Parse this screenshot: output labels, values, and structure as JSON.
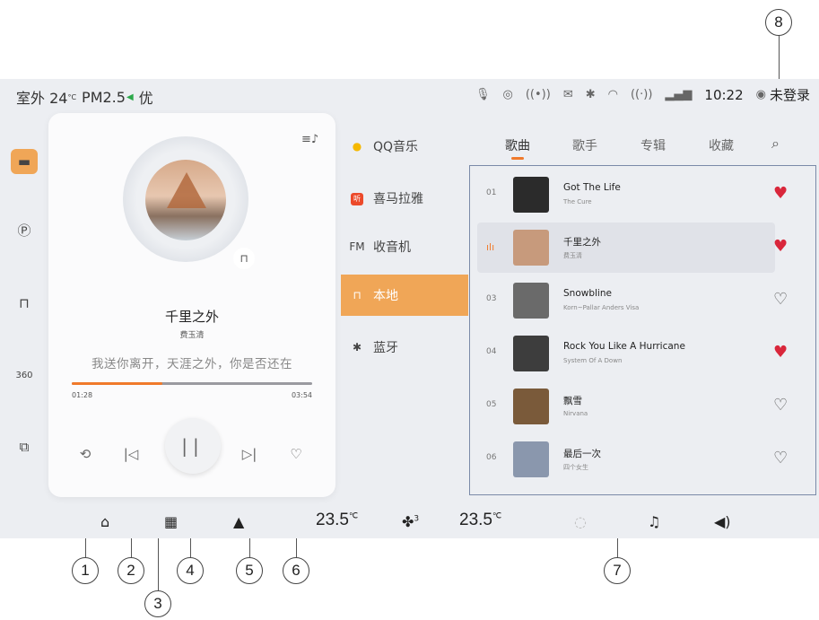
{
  "status": {
    "outdoor": "室外 24",
    "temp_unit": "°C",
    "pm": "PM2.5",
    "air": "优",
    "time": "10:22",
    "login": "未登录"
  },
  "player": {
    "title": "千里之外",
    "artist": "费玉清",
    "lyric": "我送你离开，天涯之外，你是否还在",
    "elapsed": "01:28",
    "duration": "03:54",
    "progress": 0.376
  },
  "sources": [
    {
      "icon": "qq-music-icon",
      "label": "QQ音乐"
    },
    {
      "icon": "himalaya-icon",
      "label": "喜马拉雅"
    },
    {
      "icon": "FM",
      "label": "收音机"
    },
    {
      "icon": "local-music-icon",
      "label": "本地"
    },
    {
      "icon": "bluetooth-icon",
      "label": "蓝牙"
    }
  ],
  "tabs": [
    "歌曲",
    "歌手",
    "专辑",
    "收藏"
  ],
  "songs": [
    {
      "num": "01",
      "title": "Got The Life",
      "artist": "The Cure",
      "fav": true,
      "color": "#2b2b2b"
    },
    {
      "num": "",
      "title": "千里之外",
      "artist": "费玉清",
      "fav": true,
      "color": "#c79a7c",
      "playing": true
    },
    {
      "num": "03",
      "title": "Snowbline",
      "artist": "Korn~Pallar Anders Visa",
      "fav": false,
      "color": "#6a6a6a"
    },
    {
      "num": "04",
      "title": "Rock You Like A Hurricane",
      "artist": "System Of A Down",
      "fav": true,
      "color": "#3d3d3d"
    },
    {
      "num": "05",
      "title": "飘雪",
      "artist": "Nirvana",
      "fav": false,
      "color": "#7a5a3a"
    },
    {
      "num": "06",
      "title": "最后一次",
      "artist": "四个女生",
      "fav": false,
      "color": "#8a97ad"
    }
  ],
  "dock": {
    "temp_left": "23.5",
    "temp_right": "23.5",
    "temp_unit": "℃",
    "fan_level": "3"
  },
  "callouts": [
    "1",
    "2",
    "3",
    "4",
    "5",
    "6",
    "7",
    "8"
  ],
  "colors": {
    "accent": "#f07a2b",
    "source_active": "#f0a657",
    "heart": "#d9263b"
  }
}
